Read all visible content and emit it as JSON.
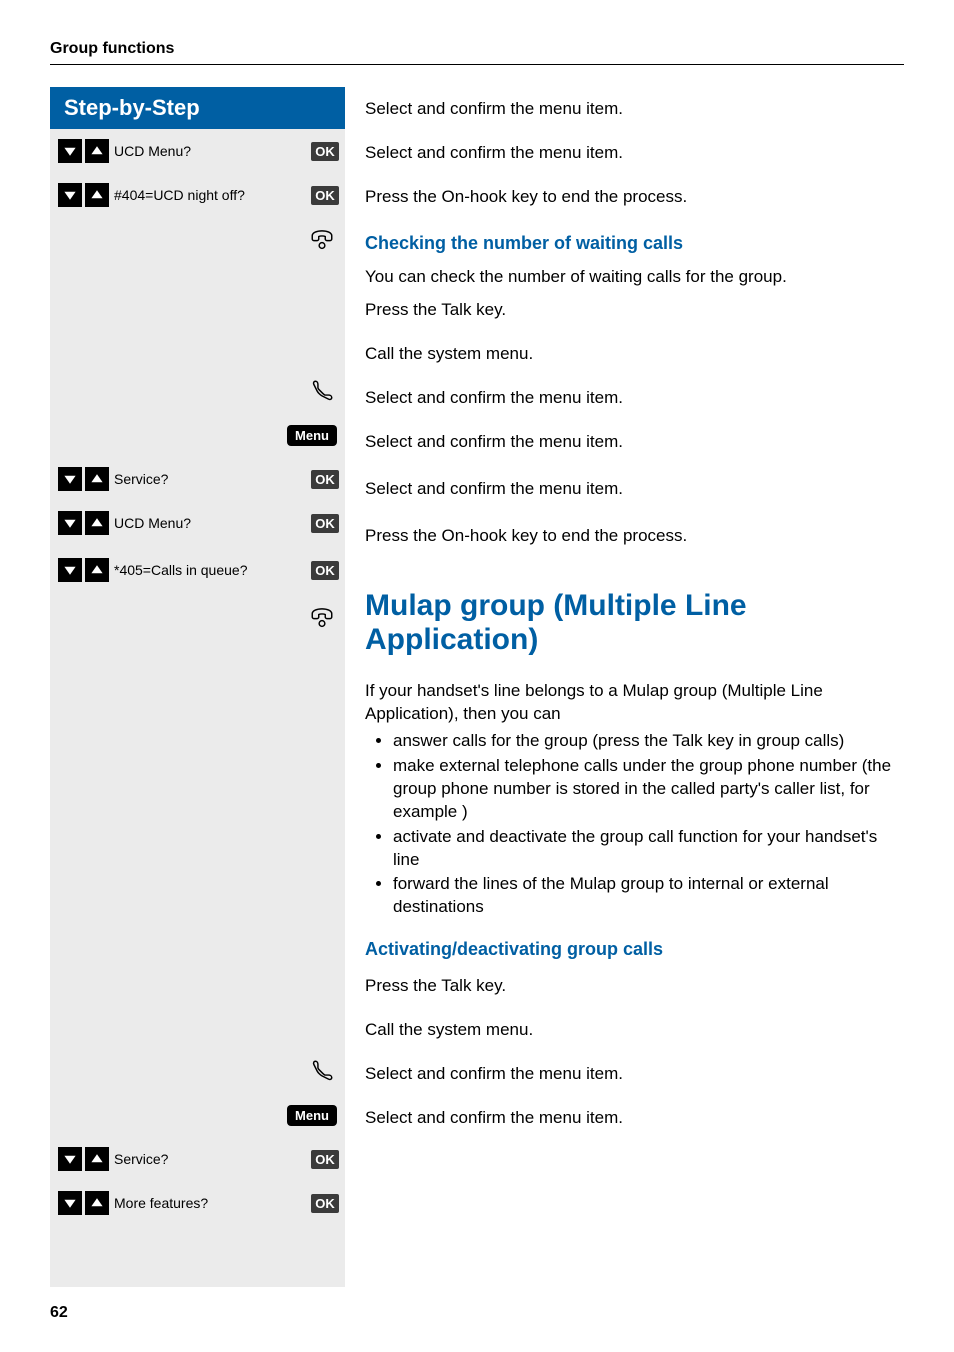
{
  "header": {
    "title": "Group functions"
  },
  "sbs": {
    "title": "Step-by-Step",
    "ok": "OK",
    "menu": "Menu",
    "rows": {
      "r1": "UCD Menu?",
      "r2": "#404=UCD night off?",
      "r3": "Service?",
      "r4": "UCD Menu?",
      "r5": "*405=Calls in queue?",
      "r6": "Service?",
      "r7": "More features?"
    }
  },
  "right": {
    "t1": "Select and confirm the menu item.",
    "t2": "Select and confirm the menu item.",
    "t3": "Press the On-hook key to end the process.",
    "sub1": "Checking the number of waiting calls",
    "t4": "You can check the number of waiting calls for the group.",
    "t5": "Press the Talk key.",
    "t6": "Call the system menu.",
    "t7": "Select and confirm the menu item.",
    "t8": "Select and confirm the menu item.",
    "t9": "Select and confirm the menu item.",
    "t10": "Press the On-hook key to end the process.",
    "section": "Mulap group (Multiple Line Application)",
    "p1a": "If your handset's line belongs to a Mulap group (Multiple Line Application), then you can",
    "li1": "answer calls for the group (press the Talk key in group calls)",
    "li2": "make external telephone calls under the group phone number (the group phone number is stored in the called party's caller list, for example )",
    "li3": "activate and deactivate the group call function for your handset's line",
    "li4": "forward the lines of the Mulap group to internal or external destinations",
    "sub2": "Activating/deactivating group calls",
    "t11": "Press the Talk key.",
    "t12": "Call the system menu.",
    "t13": "Select and confirm the menu item.",
    "t14": "Select and confirm the menu item."
  },
  "pageNumber": "62"
}
